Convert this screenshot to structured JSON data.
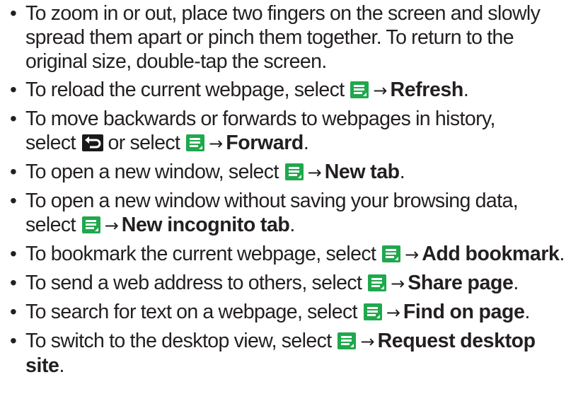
{
  "items": [
    {
      "text": "To zoom in or out, place two fingers on the screen and slowly spread them apart or pinch them together. To return to the original size, double-tap the screen."
    },
    {
      "before": "To reload the current webpage, select",
      "action": "Refresh"
    },
    {
      "before_line1": "To move backwards or forwards to webpages in history,",
      "select": "select",
      "or_select": "or select",
      "action": "Forward"
    },
    {
      "before": "To open a new window, select",
      "action": "New tab"
    },
    {
      "before_line1": "To open a new window without saving your browsing data,",
      "select": "select",
      "action": "New incognito tab"
    },
    {
      "before": "To bookmark the current webpage, select",
      "action": "Add bookmark"
    },
    {
      "before": "To send a web address to others, select",
      "action": "Share page"
    },
    {
      "before": "To search for text on a webpage, select",
      "action": "Find on page"
    },
    {
      "before": "To switch to the desktop view, select",
      "action": "Request desktop site"
    }
  ],
  "symbols": {
    "bullet": "•",
    "arrow": "→",
    "period": "."
  },
  "icons": {
    "menu_key": "menu-key-icon",
    "back_key": "back-key-icon"
  },
  "colors": {
    "text": "#231f20",
    "menu_key": "#1fa84c",
    "back_key": "#1a1a1a"
  }
}
